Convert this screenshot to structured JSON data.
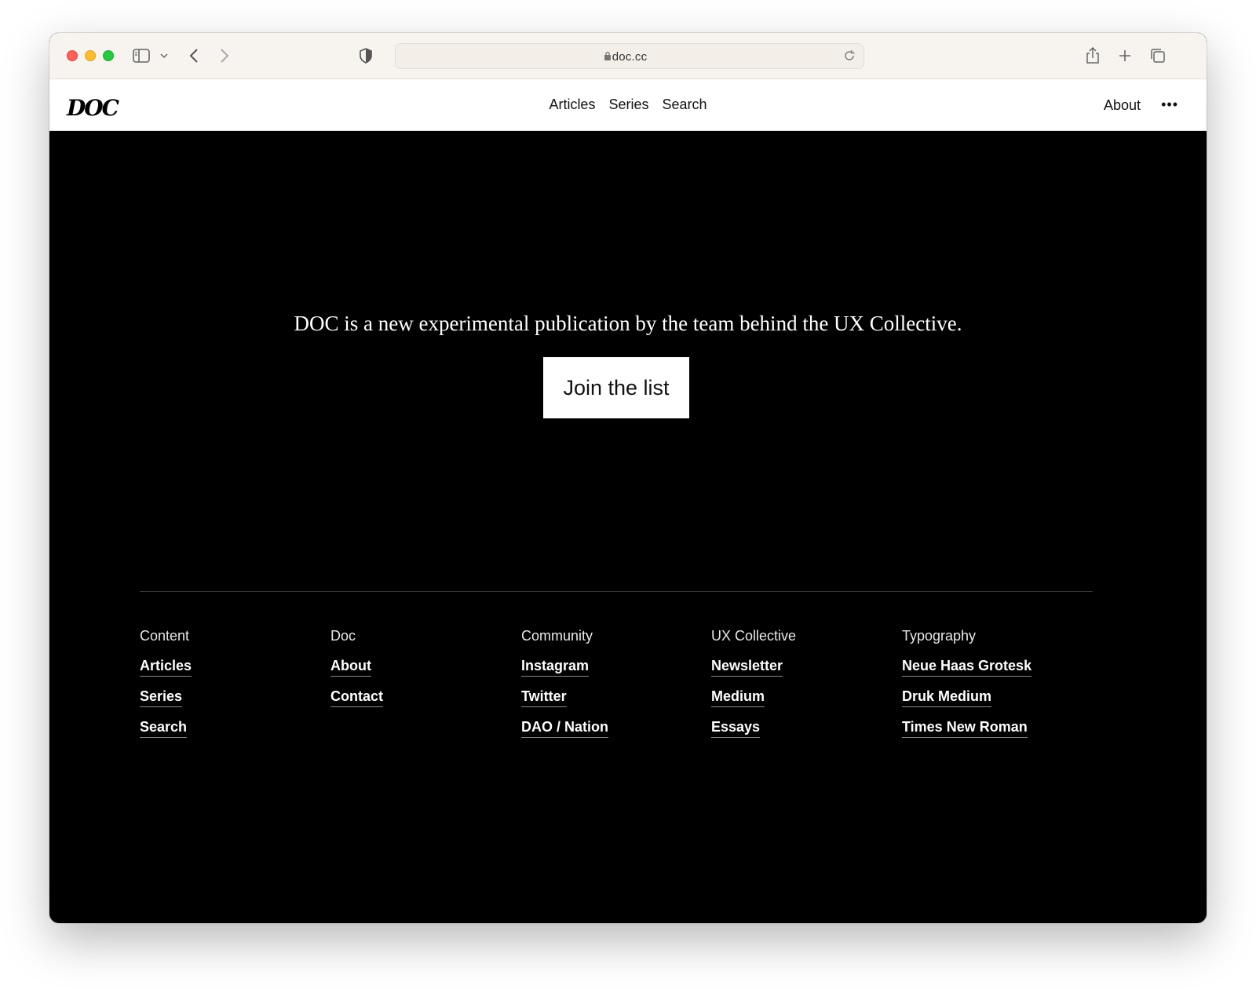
{
  "browser": {
    "url": "doc.cc",
    "icons": [
      "close-icon",
      "minimize-icon",
      "maximize-icon",
      "sidebar-icon",
      "chevron-down-icon",
      "back-icon",
      "forward-icon",
      "shield-icon",
      "lock-icon",
      "reload-icon",
      "share-icon",
      "new-tab-icon",
      "tabs-icon"
    ]
  },
  "header": {
    "logo": "DOC",
    "nav": [
      "Articles",
      "Series",
      "Search"
    ],
    "about": "About",
    "more": "•••"
  },
  "hero": {
    "text": "DOC is a new experimental publication by the team behind the UX Collective.",
    "button": "Join the list"
  },
  "footer": {
    "columns": [
      {
        "heading": "Content",
        "links": [
          "Articles",
          "Series",
          "Search"
        ]
      },
      {
        "heading": "Doc",
        "links": [
          "About",
          "Contact"
        ]
      },
      {
        "heading": "Community",
        "links": [
          "Instagram",
          "Twitter",
          "DAO / Nation"
        ]
      },
      {
        "heading": "UX Collective",
        "links": [
          "Newsletter",
          "Medium",
          "Essays"
        ]
      },
      {
        "heading": "Typography",
        "links": [
          "Neue Haas Grotesk",
          "Druk Medium",
          "Times New Roman"
        ]
      }
    ]
  },
  "colors": {
    "page_bg": "#000000",
    "header_bg": "#ffffff",
    "chrome_bg": "#f7f4ef",
    "button_bg": "#ffffff"
  }
}
